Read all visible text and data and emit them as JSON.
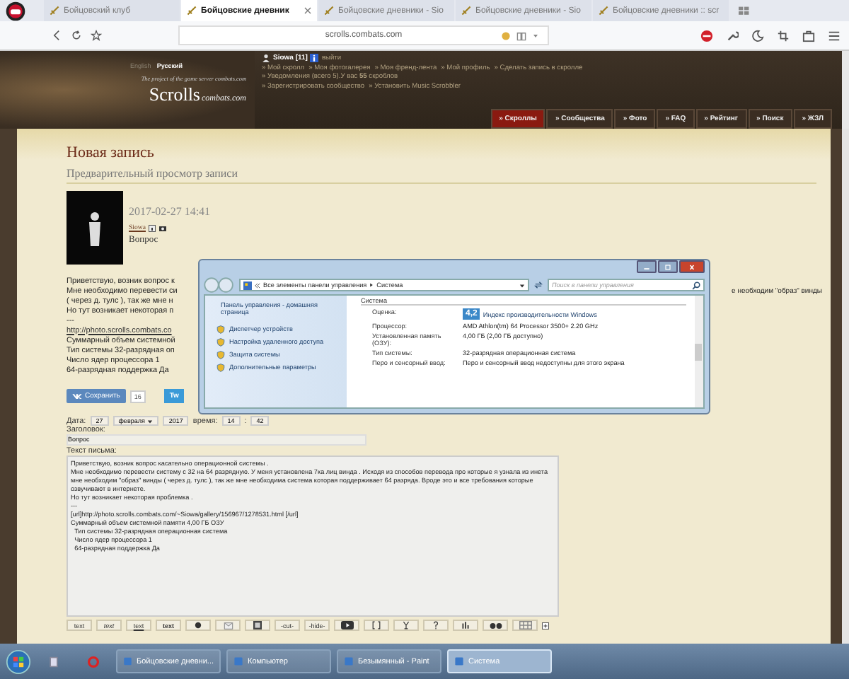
{
  "browser": {
    "tabs": [
      {
        "label": "Бойцовский клуб",
        "selected": false
      },
      {
        "label": "Бойцовские дневник",
        "selected": true
      },
      {
        "label": "Бойцовские дневники - Sio",
        "selected": false
      },
      {
        "label": "Бойцовские дневники - Sio",
        "selected": false
      },
      {
        "label": "Бойцовские дневники :: scr",
        "selected": false
      }
    ],
    "url": "scrolls.combats.com"
  },
  "header": {
    "languages": [
      {
        "label": "English",
        "selected": false
      },
      {
        "label": "Русский",
        "selected": true
      }
    ],
    "tagline": "The project of the game server combats.com",
    "logo": "Scrolls",
    "logo_sub": "combats.com",
    "user": {
      "name": "Siowa [11]",
      "logout": "выйти"
    },
    "link_rows": [
      [
        "» Мой скролл",
        "» Моя фотогалерея",
        "» Моя френд-лента",
        "» Мой профиль",
        "» Сделать запись в скролле"
      ],
      [
        "» Уведомления (всего 5).У вас **55** скроблов"
      ],
      [
        "» Зарегистрировать сообщество",
        "» Установить Music Scrobbler"
      ]
    ],
    "nav_tabs": [
      {
        "label": "» Скроллы",
        "selected": true
      },
      {
        "label": "» Сообщества",
        "selected": false
      },
      {
        "label": "» Фото",
        "selected": false
      },
      {
        "label": "» FAQ",
        "selected": false
      },
      {
        "label": "» Рейтинг",
        "selected": false
      },
      {
        "label": "» Поиск",
        "selected": false
      },
      {
        "label": "» ЖЗЛ",
        "selected": false
      }
    ]
  },
  "page": {
    "title": "Новая запись",
    "subtitle": "Предварительный просмотр записи",
    "post": {
      "date": "2017-02-27 14:41",
      "author": "Siowa",
      "title": "Вопрос",
      "lines": [
        {
          "text": "Приветствую, возник вопрос к",
          "link": false
        },
        {
          "text": "Мне необходимо перевести си",
          "link": false,
          "tail": "е необходим \"образ\" винды"
        },
        {
          "text": "( через д. тулс ), так же мне н",
          "link": false
        },
        {
          "text": "Но тут возникает некоторая п",
          "link": false
        },
        {
          "text": "---",
          "link": false
        },
        {
          "text": "http://photo.scrolls.combats.co",
          "link": true
        },
        {
          "text": "Суммарный объем системной",
          "link": false
        },
        {
          "text": "Тип системы 32-разрядная оп",
          "link": false
        },
        {
          "text": "Число ядер процессора 1",
          "link": false
        },
        {
          "text": "64-разрядная поддержка Да",
          "link": false
        }
      ]
    },
    "share": {
      "save": "Сохранить",
      "count": "16",
      "tweet": "Tw"
    },
    "form": {
      "date_label": "Дата:",
      "day": "27",
      "month": "февраля",
      "year": "2017",
      "time_label": "время:",
      "hour": "14",
      "time_separator": ":",
      "minute": "42",
      "subject_label": "Заголовок:",
      "subject": "Вопрос",
      "body_label": "Текст письма:",
      "body": "Приветствую, возник вопрос касательно операционной системы .\nМне необходимо перевести систему с 32 на 64 разрядную. У меня установлена 7ка лиц винда . Исходя из способов перевода про которые я узнала из инета мне необходим \"образ\" винды ( через д. тулс ), так же мне необходима система которая поддерживает 64 разряда. Вроде это и все требования которые озвучивают в интернете.\nНо тут возникает некоторая проблемка .\n---\n[url]http://photo.scrolls.combats.com/~Siowa/gallery/156967/1278531.html [/url]\nСуммарный объем системной памяти 4,00 ГБ ОЗУ\n  Тип системы 32-разрядная операционная система\n  Число ядер процессора 1\n  64-разрядная поддержка Да",
      "text_buttons": [
        "text",
        "text",
        "text",
        "text"
      ],
      "tag_buttons": [
        "-cut-",
        "-hide-"
      ]
    }
  },
  "dialog": {
    "address": [
      "Все элементы панели управления",
      "Система"
    ],
    "search_placeholder": "Поиск в панели управления",
    "home_link": "Панель управления - домашняя страница",
    "tasks": [
      "Диспетчер устройств",
      "Настройка удаленного доступа",
      "Защита системы",
      "Дополнительные параметры"
    ],
    "section": "Система",
    "rating_label": "Оценка:",
    "score": "4,2",
    "score_link": "Индекс производительности Windows",
    "specs": [
      {
        "label": "Процессор:",
        "value": "AMD Athlon(tm) 64 Processor 3500+   2.20 GHz"
      },
      {
        "label": "Установленная память (ОЗУ):",
        "value": "4,00 ГБ (2,00 ГБ доступно)"
      },
      {
        "label": "Тип системы:",
        "value": "32-разрядная операционная система"
      },
      {
        "label": "Перо и сенсорный ввод:",
        "value": "Перо и сенсорный ввод недоступны для этого экрана"
      }
    ]
  },
  "taskbar": [
    {
      "label": "Бойцовские дневни...",
      "selected": false
    },
    {
      "label": "Компьютер",
      "selected": false
    },
    {
      "label": "Безымянный - Paint",
      "selected": false
    },
    {
      "label": "Система",
      "selected": true
    }
  ]
}
